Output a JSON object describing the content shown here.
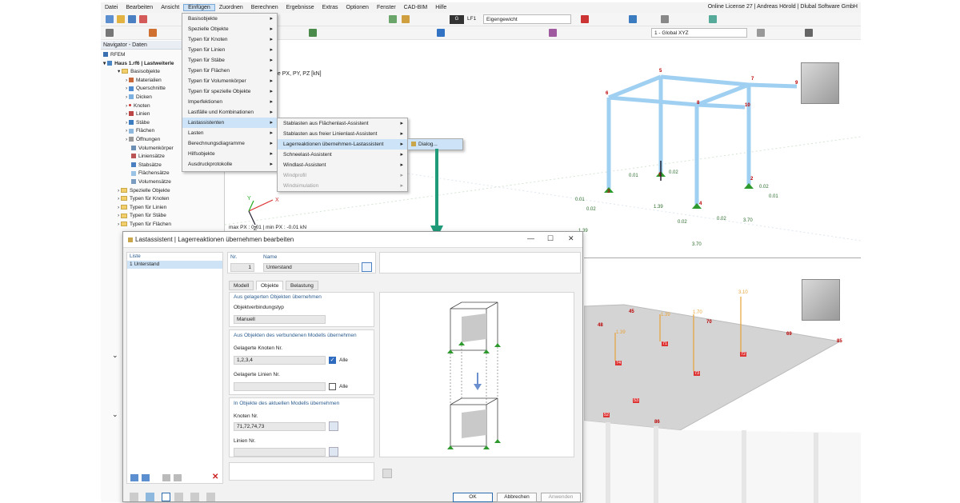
{
  "menubar": {
    "items": [
      "Datei",
      "Bearbeiten",
      "Ansicht",
      "Einfügen",
      "Zuordnen",
      "Berechnen",
      "Ergebnisse",
      "Extras",
      "Optionen",
      "Fenster",
      "CAD-BIM",
      "Hilfe"
    ],
    "license": "Online License 27 | Andreas Hörold | Dlubal Software GmbH"
  },
  "toolbar": {
    "loadcase_code": "G",
    "loadcase_id": "LF1",
    "loadcase_name": "Eigengewicht",
    "coord_system": "1 - Global XYZ"
  },
  "navigator": {
    "title": "Navigator - Daten",
    "root": "RFEM",
    "model": "Haus 1.rf6 | Lastweiterle",
    "items": [
      "Basisobjekte",
      "Materialien",
      "Querschnitte",
      "Dicken",
      "Knoten",
      "Linien",
      "Stäbe",
      "Flächen",
      "Öffnungen",
      "Volumenkörper",
      "Liniensätze",
      "Stabsätze",
      "Flächensätze",
      "Volumensätze",
      "Spezielle Objekte",
      "Typen für Knoten",
      "Typen für Linien",
      "Typen für Stäbe",
      "Typen für Flächen"
    ]
  },
  "menu1": {
    "items": [
      "Basisobjekte",
      "Spezielle Objekte",
      "Typen für Knoten",
      "Typen für Linien",
      "Typen für Stäbe",
      "Typen für Flächen",
      "Typen für Volumenkörper",
      "Typen für spezielle Objekte",
      "Imperfektionen",
      "Lastfälle und Kombinationen",
      "Lastassistenten",
      "Lasten",
      "Berechnungsdiagramme",
      "Hilfsobjekte",
      "Ausdruckprotokolle"
    ]
  },
  "menu2": {
    "items": [
      "Stablasten aus Flächenlast-Assistent",
      "Stablasten aus freier Linienlast-Assistent",
      "Lagerreaktionen übernehmen-Lastassistent",
      "Schneelast-Assistent",
      "Windlast-Assistent",
      "Windprofil",
      "Windsimulation"
    ]
  },
  "menu3": {
    "item": "Dialog..."
  },
  "view1": {
    "result_label": "fte P",
    "result_sub": "X, PY, PZ [kN]",
    "maxmin": "max P",
    "maxmin_rest": "X : 0.01 | min P",
    "maxmin_end": "X : -0.01 kN",
    "axis_x": "X",
    "axis_z": "Z",
    "axis_y": "Y",
    "nodes": [
      "1",
      "2",
      "3",
      "4",
      "5",
      "6",
      "7",
      "8",
      "9",
      "10"
    ],
    "vals": [
      "0.01",
      "0.02",
      "0.01",
      "0.02",
      "0.02",
      "1.39",
      "0.02",
      "0.01",
      "0.02",
      "3.70",
      "1.39",
      "3.70",
      "0.01",
      "0.02"
    ]
  },
  "view2": {
    "nodes": [
      "45",
      "48",
      "70",
      "69",
      "85",
      "71",
      "72",
      "74",
      "73",
      "53",
      "52",
      "86"
    ],
    "loads": [
      "1.39",
      "1.70",
      "3.10",
      "1.39"
    ]
  },
  "dialog": {
    "title": "Lastassistent | Lagerreaktionen übernehmen bearbeiten",
    "list_header": "Liste",
    "list_item_no": "1",
    "list_item": "Unterstand",
    "nr_label": "Nr.",
    "nr_value": "1",
    "name_label": "Name",
    "name_value": "Unterstand",
    "tabs": [
      "Modell",
      "Objekte",
      "Belastung"
    ],
    "sec1": "Aus gelagerten Objekten übernehmen",
    "obj_type_label": "Objektverbindungstyp",
    "obj_type_value": "Manuell",
    "sec2": "Aus Objekten des verbundenen Modells übernehmen",
    "nodes_label": "Gelagerte Knoten Nr.",
    "nodes_value": "1,2,3,4",
    "all1": "Alle",
    "lines_label": "Gelagerte Linien Nr.",
    "all2": "Alle",
    "sec3": "In Objekte des aktuellen Modells übernehmen",
    "knoten_label": "Knoten Nr.",
    "knoten_value": "71,72,74,73",
    "linien_label": "Linien Nr.",
    "ok": "OK",
    "cancel": "Abbrechen",
    "apply": "Anwenden"
  }
}
